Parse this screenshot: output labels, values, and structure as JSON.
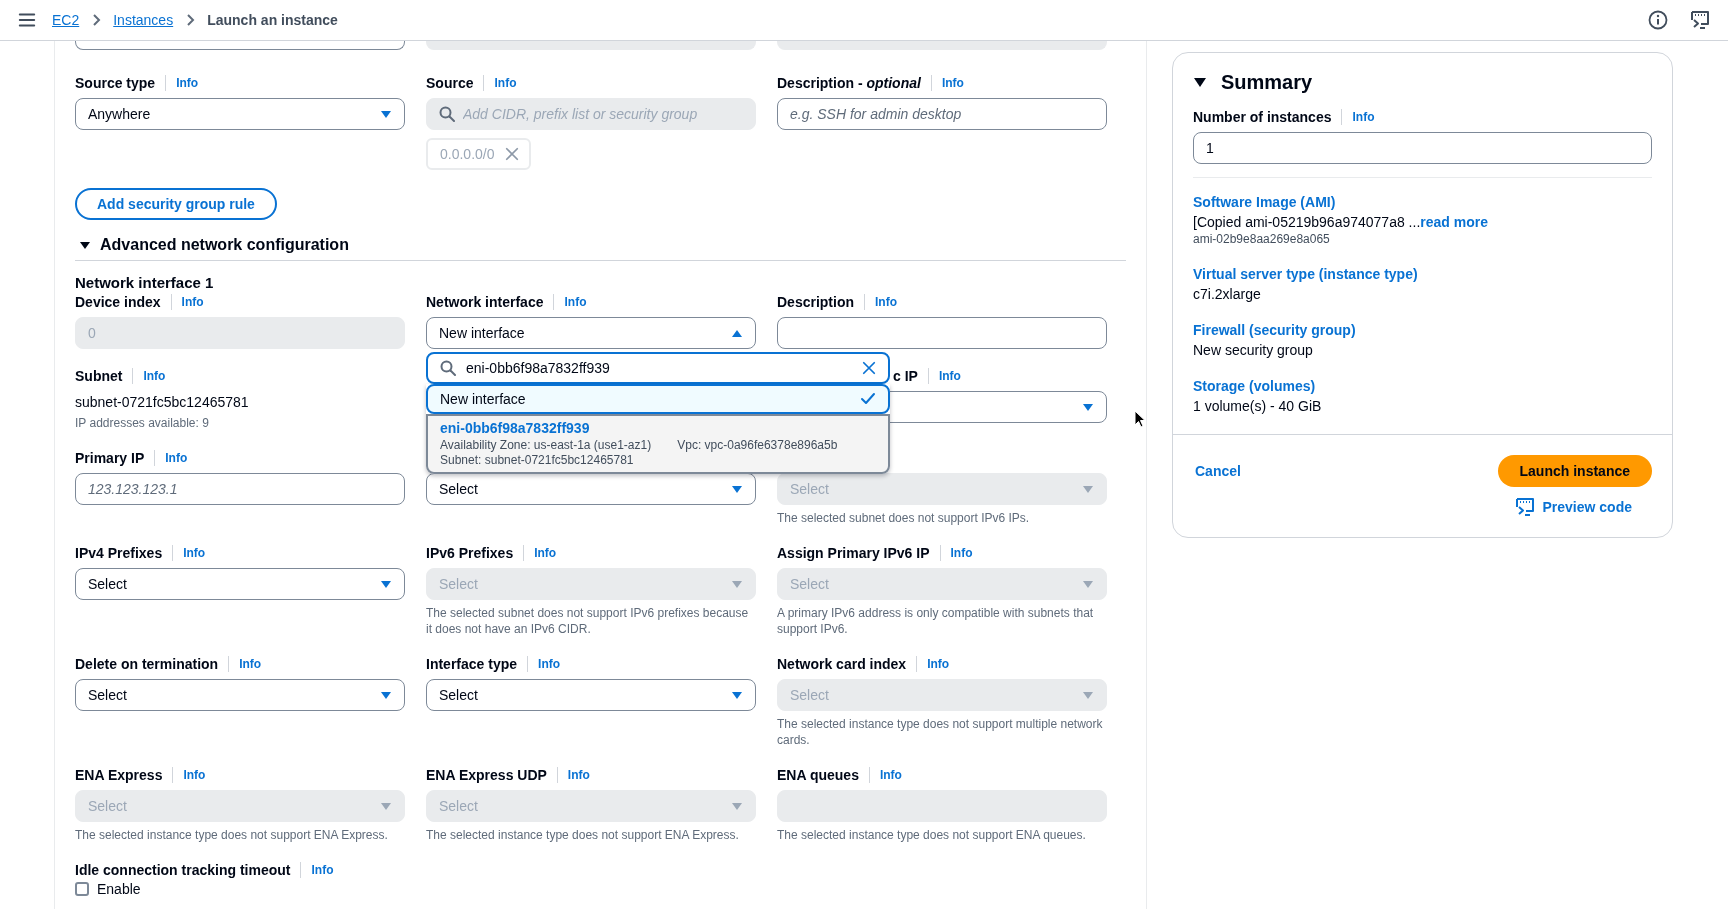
{
  "top_bar": {
    "breadcrumbs": [
      {
        "label": "EC2",
        "link": true
      },
      {
        "label": "Instances",
        "link": true
      },
      {
        "label": "Launch an instance",
        "link": false
      }
    ]
  },
  "form": {
    "partial_fields": [
      {
        "disabled": false
      },
      {
        "disabled": true
      },
      {
        "disabled": true
      }
    ],
    "rule_fields": [
      {
        "label": "Source type",
        "info": "Info",
        "kind": "select",
        "value": "Anywhere",
        "disabled": false
      },
      {
        "label": "Source",
        "info": "Info",
        "kind": "search",
        "placeholder": "Add CIDR, prefix list or security group",
        "disabled": true,
        "chips": [
          "0.0.0.0/0"
        ]
      },
      {
        "label": "Description - *optional*",
        "info": "Info",
        "kind": "text",
        "placeholder": "e.g. SSH for admin desktop",
        "disabled": false
      }
    ],
    "add_rule_button": "Add security group rule",
    "advanced": {
      "title": "Advanced network configuration",
      "expanded": true
    },
    "network_interface": {
      "title": "Network interface 1",
      "fields": [
        {
          "label": "Device index",
          "info": "Info",
          "kind": "text",
          "value": "0",
          "disabled": true
        },
        {
          "label": "Network interface",
          "info": "Info",
          "kind": "select",
          "value": "New interface",
          "disabled": false,
          "open": true,
          "menu": {
            "search_value": "eni-0bb6f98a7832ff939",
            "options": [
              {
                "label": "New interface",
                "selected": true,
                "highlighted": false
              },
              {
                "label": "eni-0bb6f98a7832ff939",
                "selected": false,
                "highlighted": true,
                "details": [
                  "Availability Zone: us-east-1a (use1-az1)",
                  "Vpc: vpc-0a96fe6378e896a5b",
                  "Subnet: subnet-0721fc5bc12465781"
                ]
              }
            ]
          }
        },
        {
          "label": "Description",
          "info": "Info",
          "kind": "text",
          "disabled": false
        },
        {
          "label": "Subnet",
          "info": "Info",
          "kind": "static",
          "value": "subnet-0721fc5bc12465781",
          "help": "IP addresses available: 9"
        },
        {
          "kind": "covered"
        },
        {
          "label": "c IP",
          "info": "Info",
          "kind": "select",
          "disabled": false,
          "label_covered": true
        },
        {
          "label": "Primary IP",
          "info": "Info",
          "kind": "text",
          "placeholder": "123.123.123.1",
          "disabled": false
        },
        {
          "kind": "select",
          "placeholder": "Select",
          "disabled": false
        },
        {
          "kind": "select",
          "placeholder": "Select",
          "disabled": true,
          "help": "The selected subnet does not support IPv6 IPs."
        },
        {
          "label": "IPv4 Prefixes",
          "info": "Info",
          "kind": "select",
          "placeholder": "Select",
          "disabled": false
        },
        {
          "label": "IPv6 Prefixes",
          "info": "Info",
          "kind": "select",
          "placeholder": "Select",
          "disabled": true,
          "help": "The selected subnet does not support IPv6 prefixes because it does not have an IPv6 CIDR."
        },
        {
          "label": "Assign Primary IPv6 IP",
          "info": "Info",
          "kind": "select",
          "placeholder": "Select",
          "disabled": true,
          "help": "A primary IPv6 address is only compatible with subnets that support IPv6."
        },
        {
          "label": "Delete on termination",
          "info": "Info",
          "kind": "select",
          "placeholder": "Select",
          "disabled": false
        },
        {
          "label": "Interface type",
          "info": "Info",
          "kind": "select",
          "placeholder": "Select",
          "disabled": false
        },
        {
          "label": "Network card index",
          "info": "Info",
          "kind": "select",
          "placeholder": "Select",
          "disabled": true,
          "help": "The selected instance type does not support multiple network cards."
        },
        {
          "label": "ENA Express",
          "info": "Info",
          "kind": "select",
          "placeholder": "Select",
          "disabled": true,
          "help": "The selected instance type does not support ENA Express."
        },
        {
          "label": "ENA Express UDP",
          "info": "Info",
          "kind": "select",
          "placeholder": "Select",
          "disabled": true,
          "help": "The selected instance type does not support ENA Express."
        },
        {
          "label": "ENA queues",
          "info": "Info",
          "kind": "text",
          "disabled": true,
          "help": "The selected instance type does not support ENA queues."
        },
        {
          "label": "Idle connection tracking timeout",
          "info": "Info",
          "kind": "checkbox",
          "option": "Enable",
          "checked": false
        }
      ]
    }
  },
  "summary": {
    "title": "Summary",
    "expanded": true,
    "instances_label": "Number of instances",
    "instances_info": "Info",
    "instances_value": "1",
    "items": [
      {
        "title": "Software Image (AMI)",
        "value": "[Copied ami-05219b96a974077a8 ...",
        "link": "read more",
        "sub": "ami-02b9e8aa269e8a065"
      },
      {
        "title": "Virtual server type (instance type)",
        "value": "c7i.2xlarge"
      },
      {
        "title": "Firewall (security group)",
        "value": "New security group"
      },
      {
        "title": "Storage (volumes)",
        "value": "1 volume(s) - 40 GiB"
      }
    ],
    "cancel": "Cancel",
    "launch": "Launch instance",
    "preview": "Preview code"
  }
}
